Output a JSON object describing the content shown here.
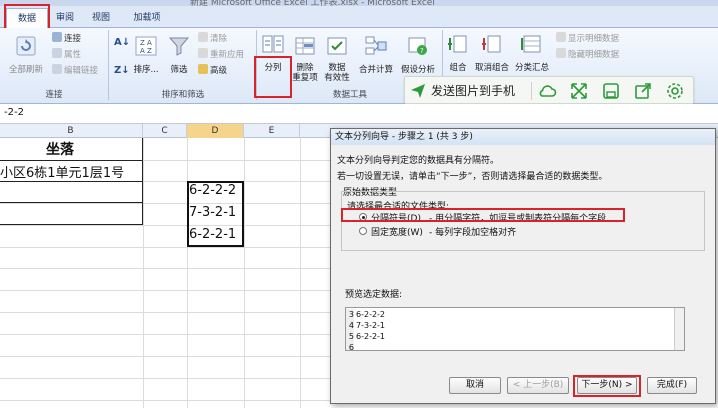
{
  "window": {
    "title": "新建 Microsoft Office Excel 工作表.xlsx - Microsoft Excel"
  },
  "tabs": [
    {
      "label": "数据",
      "active": true
    },
    {
      "label": "审阅"
    },
    {
      "label": "视图"
    },
    {
      "label": "加载项"
    }
  ],
  "ribbon": {
    "connections": {
      "refresh_all": "全部刷新",
      "connections": "连接",
      "properties": "属性",
      "edit_links": "编辑链接",
      "group_label": "连接"
    },
    "sort_filter": {
      "sort": "排序...",
      "filter": "筛选",
      "clear": "清除",
      "reapply": "重新应用",
      "advanced": "高级",
      "group_label": "排序和筛选"
    },
    "data_tools": {
      "text_to_columns": "分列",
      "remove_duplicates": "删除\n重复项",
      "data_validation": "数据\n有效性",
      "consolidate": "合并计算",
      "what_if": "假设分析",
      "group_label": "数据工具"
    },
    "outline": {
      "group": "组合",
      "ungroup": "取消组合",
      "subtotal": "分类汇总",
      "show_detail": "显示明细数据",
      "hide_detail": "隐藏明细数据"
    }
  },
  "quick_bar": {
    "send_label": "发送图片到手机",
    "icons": [
      "cloud-icon",
      "expand-icon",
      "save-icon",
      "share-icon",
      "settings-icon"
    ]
  },
  "formula_bar": {
    "value": "-2-2"
  },
  "sheet": {
    "columns": [
      "B",
      "C",
      "D",
      "E"
    ],
    "b_header": "坐落",
    "b_row2": "小区6栋1单元1层1号",
    "d_values": [
      "6-2-2-2",
      "7-3-2-1",
      "6-2-2-1"
    ]
  },
  "dialog": {
    "title": "文本分列向导 - 步骤之 1 (共 3 步)",
    "line1": "文本分列向导判定您的数据具有分隔符。",
    "line2": "若一切设置无误，请单击“下一步”，否则请选择最合适的数据类型。",
    "group_title": "原始数据类型",
    "choose_type": "请选择最合适的文件类型:",
    "option_delimited": "分隔符号(D)",
    "option_delimited_desc": "- 用分隔字符，如逗号或制表符分隔每个字段",
    "option_fixed": "固定宽度(W)",
    "option_fixed_desc": "- 每列字段加空格对齐",
    "preview_label": "预览选定数据:",
    "preview_rows": [
      {
        "num": "3",
        "text": "6-2-2-2"
      },
      {
        "num": "4",
        "text": "7-3-2-1"
      },
      {
        "num": "5",
        "text": "6-2-2-1"
      },
      {
        "num": "6",
        "text": ""
      }
    ],
    "buttons": {
      "cancel": "取消",
      "back": "< 上一步(B)",
      "next": "下一步(N) >",
      "finish": "完成(F)"
    }
  },
  "colors": {
    "highlight_red": "#d8232a",
    "ribbon_bg": "#dde8f7",
    "dialog_bg": "#f0f0f0"
  }
}
